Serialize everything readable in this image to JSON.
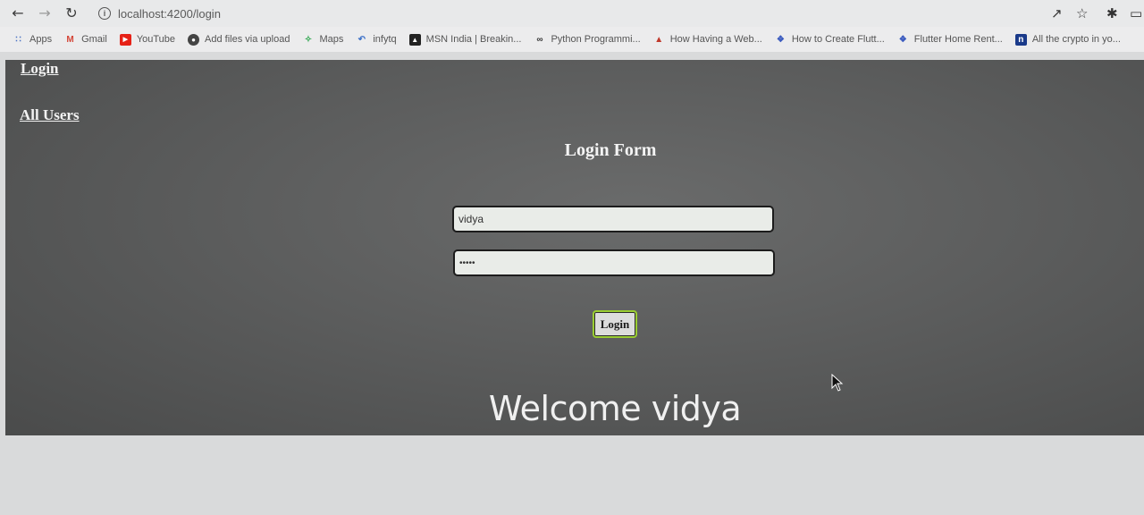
{
  "browser": {
    "url": "localhost:4200/login",
    "bookmarks": [
      {
        "label": "Apps",
        "icon": "apps-grid-icon"
      },
      {
        "label": "Gmail",
        "icon": "gmail-icon"
      },
      {
        "label": "YouTube",
        "icon": "youtube-icon"
      },
      {
        "label": "Add files via upload",
        "icon": "github-icon"
      },
      {
        "label": "Maps",
        "icon": "maps-icon"
      },
      {
        "label": "infytq",
        "icon": "infytq-icon"
      },
      {
        "label": "MSN India | Breakin...",
        "icon": "msn-icon"
      },
      {
        "label": "Python Programmi...",
        "icon": "python-icon"
      },
      {
        "label": "How Having a Web...",
        "icon": "web-icon"
      },
      {
        "label": "How to Create Flutt...",
        "icon": "flutter-icon"
      },
      {
        "label": "Flutter Home Rent...",
        "icon": "flutter-icon"
      },
      {
        "label": "All the crypto in yo...",
        "icon": "notion-icon"
      }
    ]
  },
  "nav": {
    "login_label": "Login",
    "all_users_label": "All Users"
  },
  "form": {
    "title": "Login Form",
    "username_value": "vidya",
    "password_value": "•••••",
    "submit_label": "Login"
  },
  "welcome": {
    "text": "Welcome vidya"
  }
}
